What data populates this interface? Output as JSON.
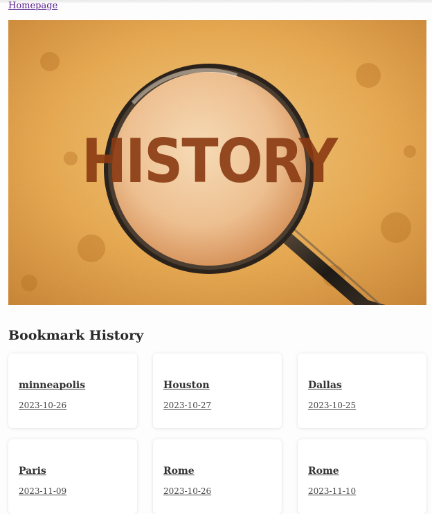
{
  "nav": {
    "home_label": "Homepage"
  },
  "hero": {
    "image_text": "HISTORY"
  },
  "section": {
    "title": "Bookmark History"
  },
  "bookmarks": [
    {
      "city": "minneapolis",
      "date": "2023-10-26"
    },
    {
      "city": "Houston",
      "date": "2023-10-27"
    },
    {
      "city": "Dallas",
      "date": "2023-10-25"
    },
    {
      "city": "Paris",
      "date": "2023-11-09"
    },
    {
      "city": "Rome",
      "date": "2023-10-26"
    },
    {
      "city": "Rome",
      "date": "2023-11-10"
    }
  ],
  "colors": {
    "link": "#551a8b",
    "hero_background": "#e8a543",
    "lens": "#f0c08a",
    "stencil_text": "#8a3a12"
  }
}
